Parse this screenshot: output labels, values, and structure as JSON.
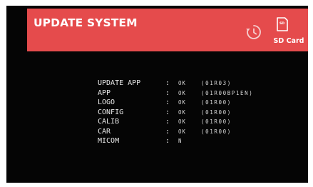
{
  "header": {
    "title": "UPDATE SYSTEM",
    "background_color": "#e54b4c",
    "history_icon": "history-icon",
    "sd_card": {
      "icon": "sd-card-icon",
      "icon_text": "SD",
      "label": "SD Card"
    }
  },
  "status_list": [
    {
      "name": "UPDATE APP",
      "separator": ":",
      "status": "OK",
      "version": "(01R03)"
    },
    {
      "name": "APP",
      "separator": ":",
      "status": "OK",
      "version": "(01R00BP1EN)"
    },
    {
      "name": "LOGO",
      "separator": ":",
      "status": "OK",
      "version": "(01R00)"
    },
    {
      "name": "CONFIG",
      "separator": ":",
      "status": "OK",
      "version": "(01R00)"
    },
    {
      "name": "CALIB",
      "separator": ":",
      "status": "OK",
      "version": "(01R00)"
    },
    {
      "name": "CAR",
      "separator": ":",
      "status": "OK",
      "version": "(01R00)"
    },
    {
      "name": "MICOM",
      "separator": ":",
      "status": "N",
      "version": ""
    }
  ]
}
